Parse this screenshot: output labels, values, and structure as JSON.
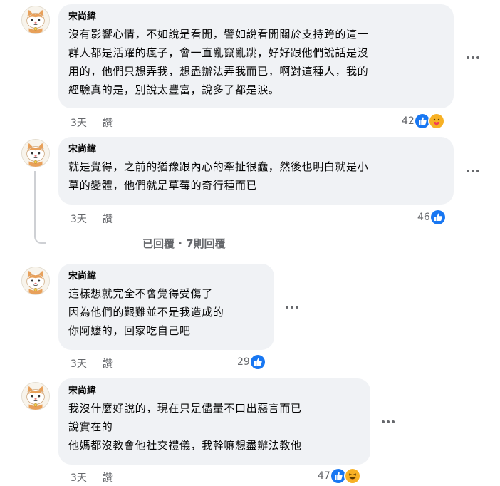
{
  "comments": [
    {
      "author": "宋尚緯",
      "lines": [
        "沒有影響心情，不如說是看開，譬如說看開關於支持跨的這一",
        "群人都是活躍的瘋子，會一直亂竄亂跳，好好跟他們說話是沒",
        "用的，他們只想弄我，想盡辦法弄我而已，啊對這種人，我的",
        "經驗真的是，別說太豐富，說多了都是淚。"
      ],
      "time": "3天",
      "like_label": "讚",
      "reaction_count": "42",
      "reactions": [
        "like-icon",
        "care-icon"
      ]
    },
    {
      "author": "宋尚緯",
      "lines": [
        "就是覺得，之前的猶豫跟內心的牽扯很蠢，然後也明白就是小",
        "草的變體，他們就是草莓的奇行種而已"
      ],
      "time": "3天",
      "like_label": "讚",
      "reaction_count": "46",
      "reactions": [
        "like-icon"
      ]
    },
    {
      "author": "宋尚緯",
      "lines": [
        "這樣想就完全不會覺得受傷了",
        "因為他們的艱難並不是我造成的",
        "你阿嬤的，回家吃自己吧"
      ],
      "time": "3天",
      "like_label": "讚",
      "reaction_count": "29",
      "reactions": [
        "like-icon"
      ]
    },
    {
      "author": "宋尚緯",
      "lines": [
        "我沒什麼好說的，現在只是儘量不口出惡言而已",
        "說實在的",
        "他媽都沒教會他社交禮儀，我幹嘛想盡辦法教他"
      ],
      "time": "3天",
      "like_label": "讚",
      "reaction_count": "47",
      "reactions": [
        "like-icon",
        "haha-icon"
      ]
    }
  ],
  "replies_link": "已回覆 · 7則回覆",
  "colors": {
    "bubble": "#f0f2f5",
    "meta_text": "#65676b",
    "like_blue": "#1877f2"
  }
}
